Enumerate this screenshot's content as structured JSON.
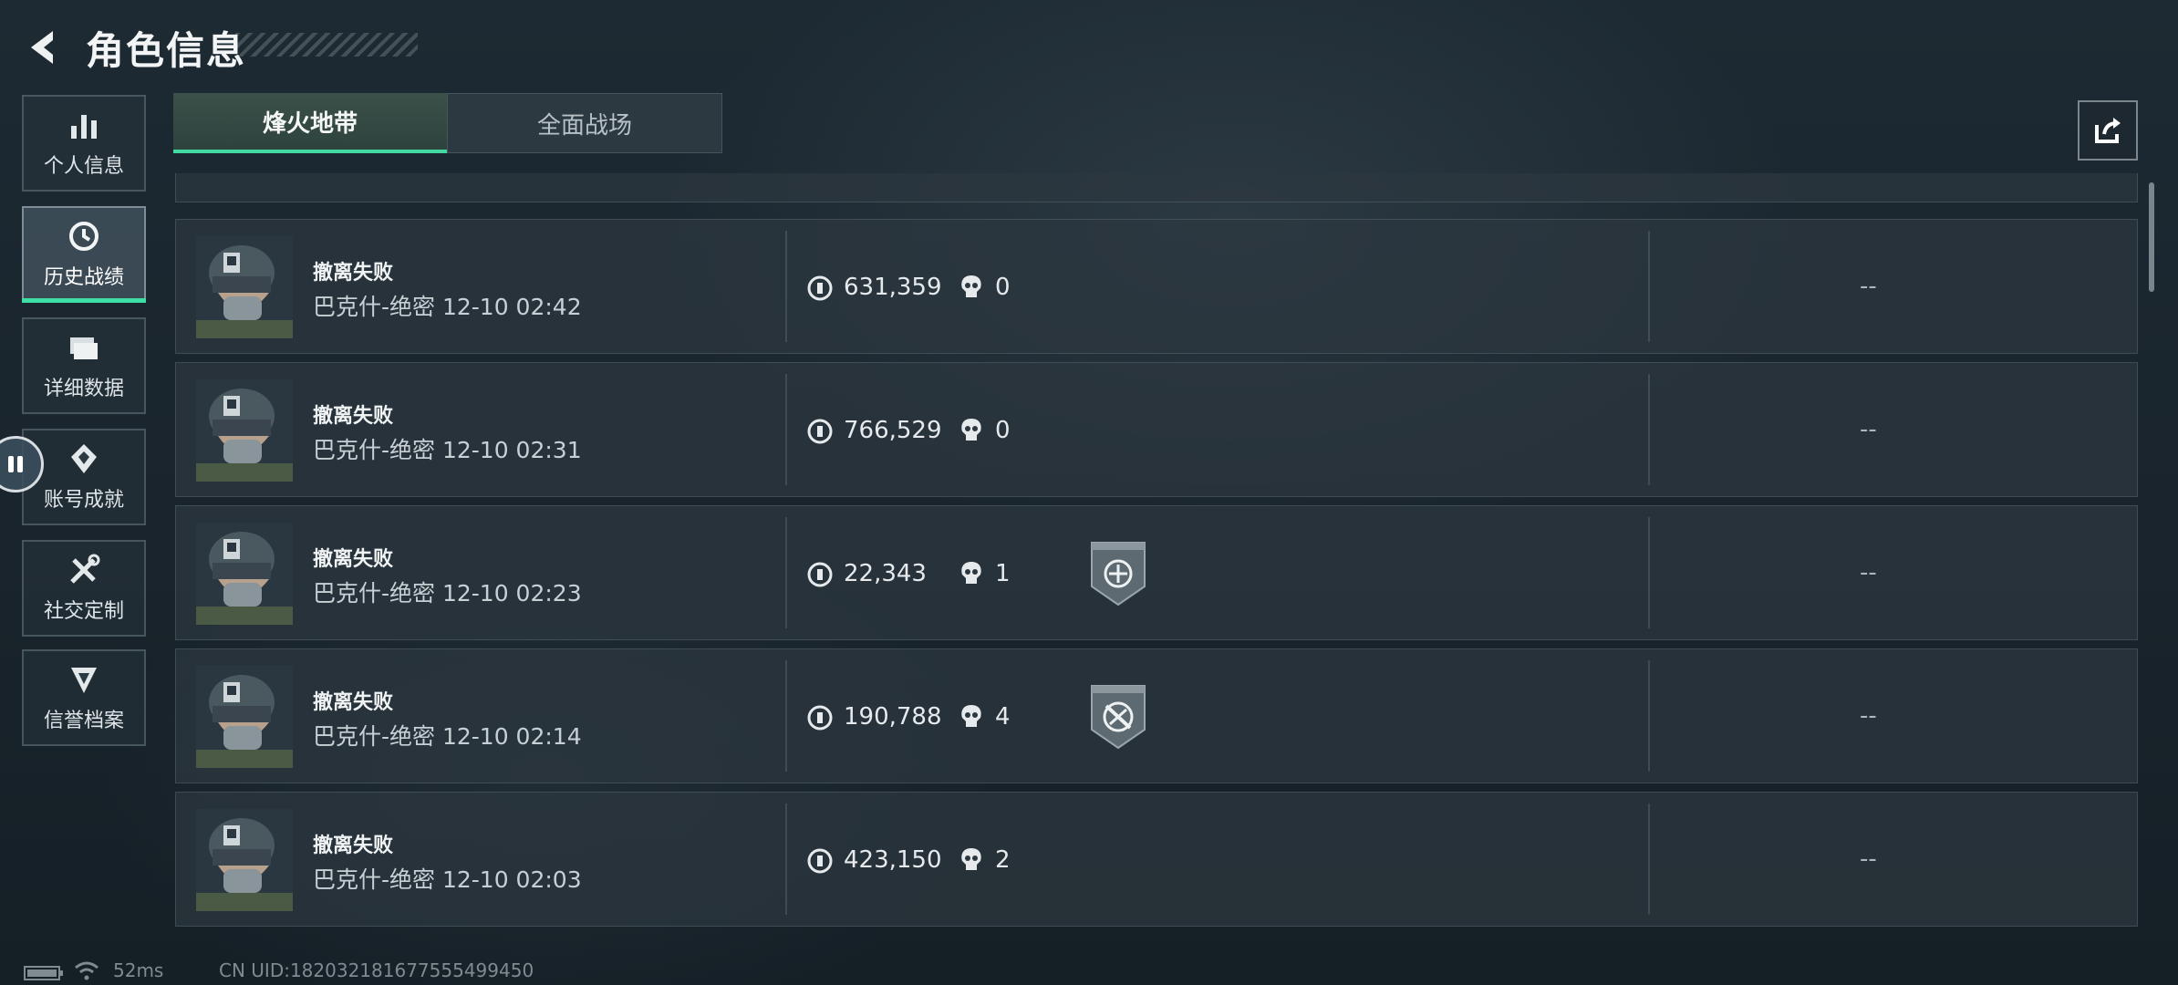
{
  "header": {
    "title": "角色信息"
  },
  "sidebar": {
    "items": [
      {
        "label": "个人信息",
        "icon": "bar-chart-icon",
        "active": false
      },
      {
        "label": "历史战绩",
        "icon": "history-clock-icon",
        "active": true
      },
      {
        "label": "详细数据",
        "icon": "folder-icon",
        "active": false
      },
      {
        "label": "账号成就",
        "icon": "achievement-icon",
        "active": false
      },
      {
        "label": "社交定制",
        "icon": "tools-icon",
        "active": false
      },
      {
        "label": "信誉档案",
        "icon": "reputation-icon",
        "active": false
      }
    ]
  },
  "tabs": [
    {
      "label": "烽火地带",
      "active": true
    },
    {
      "label": "全面战场",
      "active": false
    }
  ],
  "records": [
    {
      "title": "撤离失败",
      "subtitle": "巴克什-绝密 12-10 02:42",
      "value": "631,359",
      "kills": "0",
      "badge": "",
      "result": "--"
    },
    {
      "title": "撤离失败",
      "subtitle": "巴克什-绝密 12-10 02:31",
      "value": "766,529",
      "kills": "0",
      "badge": "",
      "result": "--"
    },
    {
      "title": "撤离失败",
      "subtitle": "巴克什-绝密 12-10 02:23",
      "value": "22,343",
      "kills": "1",
      "badge": "crosshair-badge-icon",
      "result": "--"
    },
    {
      "title": "撤离失败",
      "subtitle": "巴克什-绝密 12-10 02:14",
      "value": "190,788",
      "kills": "4",
      "badge": "no-weapon-badge-icon",
      "result": "--"
    },
    {
      "title": "撤离失败",
      "subtitle": "巴克什-绝密 12-10 02:03",
      "value": "423,150",
      "kills": "2",
      "badge": "",
      "result": "--"
    }
  ],
  "status_bar": {
    "ping": "52ms",
    "uid": "CN UID:182032181677555499450"
  },
  "colors": {
    "accent": "#3ee0a5",
    "background": "#1a252d"
  }
}
